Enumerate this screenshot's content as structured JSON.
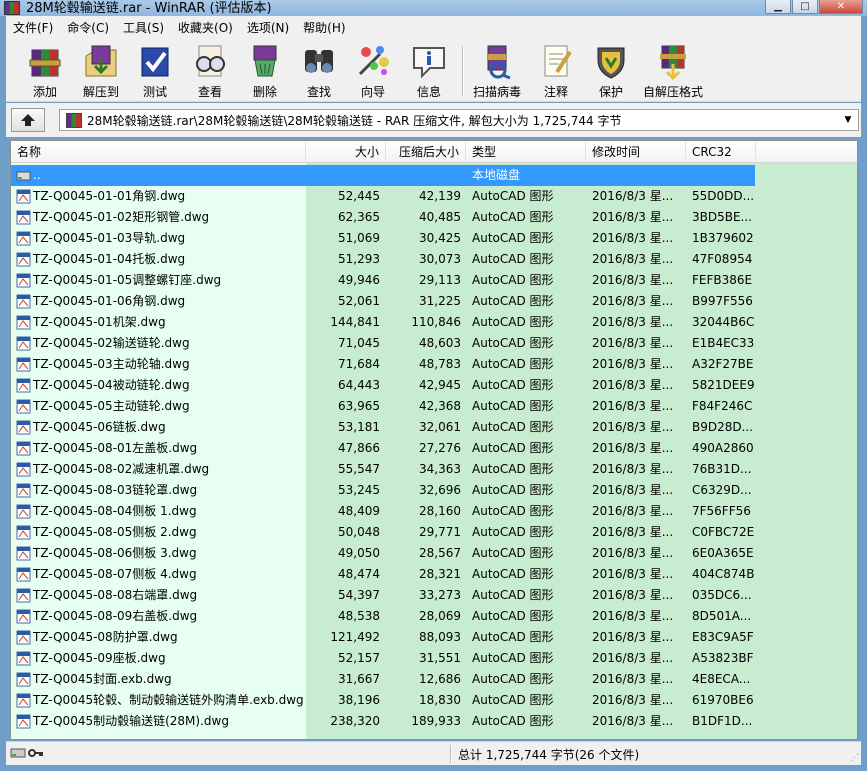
{
  "window": {
    "title": "28M轮毂输送链.rar - WinRAR (评估版本)",
    "buttons": [
      "minimize",
      "maximize",
      "close"
    ]
  },
  "menu": [
    "文件(F)",
    "命令(C)",
    "工具(S)",
    "收藏夹(O)",
    "选项(N)",
    "帮助(H)"
  ],
  "toolbar": [
    {
      "label": "添加",
      "icon": "add-archive-icon"
    },
    {
      "label": "解压到",
      "icon": "extract-to-icon"
    },
    {
      "label": "测试",
      "icon": "test-icon"
    },
    {
      "label": "查看",
      "icon": "view-icon"
    },
    {
      "label": "删除",
      "icon": "delete-icon"
    },
    {
      "label": "查找",
      "icon": "find-icon"
    },
    {
      "label": "向导",
      "icon": "wizard-icon"
    },
    {
      "label": "信息",
      "icon": "info-icon"
    },
    {
      "label": "扫描病毒",
      "icon": "virus-scan-icon"
    },
    {
      "label": "注释",
      "icon": "comment-icon"
    },
    {
      "label": "保护",
      "icon": "protect-icon"
    },
    {
      "label": "自解压格式",
      "icon": "sfx-icon"
    }
  ],
  "address": {
    "path": "28M轮毂输送链.rar\\28M轮毂输送链\\28M轮毂输送链 - RAR 压缩文件, 解包大小为 1,725,744 字节"
  },
  "columns": {
    "name": "名称",
    "size": "大小",
    "packed": "压缩后大小",
    "type": "类型",
    "modified": "修改时间",
    "crc": "CRC32"
  },
  "parent_row": {
    "name": "..",
    "type": "本地磁盘"
  },
  "files": [
    {
      "name": "TZ-Q0045-01-01角钢.dwg",
      "size": "52,445",
      "packed": "42,139",
      "type": "AutoCAD 图形",
      "modified": "2016/8/3 星...",
      "crc": "55D0DD..."
    },
    {
      "name": "TZ-Q0045-01-02矩形钢管.dwg",
      "size": "62,365",
      "packed": "40,485",
      "type": "AutoCAD 图形",
      "modified": "2016/8/3 星...",
      "crc": "3BD5BE..."
    },
    {
      "name": "TZ-Q0045-01-03导轨.dwg",
      "size": "51,069",
      "packed": "30,425",
      "type": "AutoCAD 图形",
      "modified": "2016/8/3 星...",
      "crc": "1B379602"
    },
    {
      "name": "TZ-Q0045-01-04托板.dwg",
      "size": "51,293",
      "packed": "30,073",
      "type": "AutoCAD 图形",
      "modified": "2016/8/3 星...",
      "crc": "47F08954"
    },
    {
      "name": "TZ-Q0045-01-05调整螺钉座.dwg",
      "size": "49,946",
      "packed": "29,113",
      "type": "AutoCAD 图形",
      "modified": "2016/8/3 星...",
      "crc": "FEFB386E"
    },
    {
      "name": "TZ-Q0045-01-06角钢.dwg",
      "size": "52,061",
      "packed": "31,225",
      "type": "AutoCAD 图形",
      "modified": "2016/8/3 星...",
      "crc": "B997F556"
    },
    {
      "name": "TZ-Q0045-01机架.dwg",
      "size": "144,841",
      "packed": "110,846",
      "type": "AutoCAD 图形",
      "modified": "2016/8/3 星...",
      "crc": "32044B6C"
    },
    {
      "name": "TZ-Q0045-02输送链轮.dwg",
      "size": "71,045",
      "packed": "48,603",
      "type": "AutoCAD 图形",
      "modified": "2016/8/3 星...",
      "crc": "E1B4EC33"
    },
    {
      "name": "TZ-Q0045-03主动轮轴.dwg",
      "size": "71,684",
      "packed": "48,783",
      "type": "AutoCAD 图形",
      "modified": "2016/8/3 星...",
      "crc": "A32F27BE"
    },
    {
      "name": "TZ-Q0045-04被动链轮.dwg",
      "size": "64,443",
      "packed": "42,945",
      "type": "AutoCAD 图形",
      "modified": "2016/8/3 星...",
      "crc": "5821DEE9"
    },
    {
      "name": "TZ-Q0045-05主动链轮.dwg",
      "size": "63,965",
      "packed": "42,368",
      "type": "AutoCAD 图形",
      "modified": "2016/8/3 星...",
      "crc": "F84F246C"
    },
    {
      "name": "TZ-Q0045-06链板.dwg",
      "size": "53,181",
      "packed": "32,061",
      "type": "AutoCAD 图形",
      "modified": "2016/8/3 星...",
      "crc": "B9D28D..."
    },
    {
      "name": "TZ-Q0045-08-01左盖板.dwg",
      "size": "47,866",
      "packed": "27,276",
      "type": "AutoCAD 图形",
      "modified": "2016/8/3 星...",
      "crc": "490A2860"
    },
    {
      "name": "TZ-Q0045-08-02减速机罩.dwg",
      "size": "55,547",
      "packed": "34,363",
      "type": "AutoCAD 图形",
      "modified": "2016/8/3 星...",
      "crc": "76B31D..."
    },
    {
      "name": "TZ-Q0045-08-03链轮罩.dwg",
      "size": "53,245",
      "packed": "32,696",
      "type": "AutoCAD 图形",
      "modified": "2016/8/3 星...",
      "crc": "C6329D..."
    },
    {
      "name": "TZ-Q0045-08-04侧板 1.dwg",
      "size": "48,409",
      "packed": "28,160",
      "type": "AutoCAD 图形",
      "modified": "2016/8/3 星...",
      "crc": "7F56FF56"
    },
    {
      "name": "TZ-Q0045-08-05侧板 2.dwg",
      "size": "50,048",
      "packed": "29,771",
      "type": "AutoCAD 图形",
      "modified": "2016/8/3 星...",
      "crc": "C0FBC72E"
    },
    {
      "name": "TZ-Q0045-08-06侧板 3.dwg",
      "size": "49,050",
      "packed": "28,567",
      "type": "AutoCAD 图形",
      "modified": "2016/8/3 星...",
      "crc": "6E0A365E"
    },
    {
      "name": "TZ-Q0045-08-07侧板 4.dwg",
      "size": "48,474",
      "packed": "28,321",
      "type": "AutoCAD 图形",
      "modified": "2016/8/3 星...",
      "crc": "404C874B"
    },
    {
      "name": "TZ-Q0045-08-08右端罩.dwg",
      "size": "54,397",
      "packed": "33,273",
      "type": "AutoCAD 图形",
      "modified": "2016/8/3 星...",
      "crc": "035DC6..."
    },
    {
      "name": "TZ-Q0045-08-09右盖板.dwg",
      "size": "48,538",
      "packed": "28,069",
      "type": "AutoCAD 图形",
      "modified": "2016/8/3 星...",
      "crc": "8D501A..."
    },
    {
      "name": "TZ-Q0045-08防护罩.dwg",
      "size": "121,492",
      "packed": "88,093",
      "type": "AutoCAD 图形",
      "modified": "2016/8/3 星...",
      "crc": "E83C9A5F"
    },
    {
      "name": "TZ-Q0045-09座板.dwg",
      "size": "52,157",
      "packed": "31,551",
      "type": "AutoCAD 图形",
      "modified": "2016/8/3 星...",
      "crc": "A53823BF"
    },
    {
      "name": "TZ-Q0045封面.exb.dwg",
      "size": "31,667",
      "packed": "12,686",
      "type": "AutoCAD 图形",
      "modified": "2016/8/3 星...",
      "crc": "4E8ECA..."
    },
    {
      "name": "TZ-Q0045轮毂、制动毂输送链外购清单.exb.dwg",
      "size": "38,196",
      "packed": "18,830",
      "type": "AutoCAD 图形",
      "modified": "2016/8/3 星...",
      "crc": "61970BE6"
    },
    {
      "name": "TZ-Q0045制动毂输送链(28M).dwg",
      "size": "238,320",
      "packed": "189,933",
      "type": "AutoCAD 图形",
      "modified": "2016/8/3 星...",
      "crc": "B1DF1D..."
    }
  ],
  "status": {
    "summary": "总计 1,725,744 字节(26 个文件)"
  },
  "colors": {
    "selection": "#3399ff",
    "name_col_bg": "#e6fff0",
    "data_col_bg": "#c8ecd0"
  }
}
